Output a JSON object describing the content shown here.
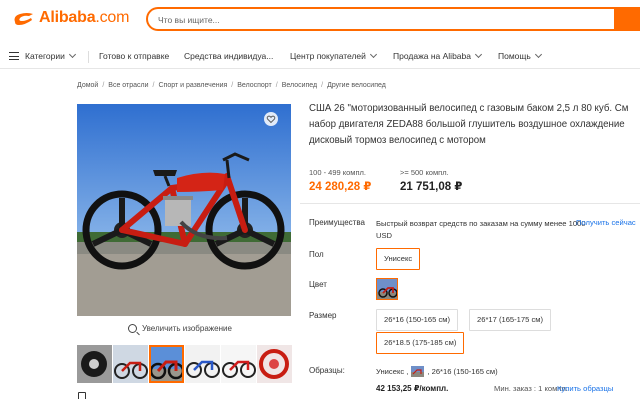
{
  "header": {
    "logo_text": "Alibaba",
    "logo_domain": ".com",
    "search_placeholder": "Что вы ищите...",
    "brand_color": "#ff6a00"
  },
  "nav": {
    "categories": "Категории",
    "items": [
      "Готово к отправке",
      "Средства индивидуа...",
      "Центр покупателей",
      "Продажа на Alibaba",
      "Помощь"
    ]
  },
  "breadcrumb": [
    "Домой",
    "Все отрасли",
    "Спорт и развлечения",
    "Велоспорт",
    "Велосипед",
    "Другие велосипед"
  ],
  "gallery": {
    "zoom_label": "Увеличить изображение",
    "thumb_count": 6,
    "selected_thumb": 2
  },
  "product": {
    "title": "США 26 \"моторизованный велосипед с газовым баком 2,5 л 80 куб. См набор двигателя ZEDA88 большой глушитель воздушное охлаждение дисковый тормоз велосипед с мотором",
    "tiers": [
      {
        "qty": "100 - 499 компл.",
        "price": "24 280,28 ₽"
      },
      {
        "qty": ">= 500 компл.",
        "price": "21 751,08 ₽"
      }
    ],
    "advantages_label": "Преимущества",
    "advantages_text": "Быстрый возврат средств по заказам на сумму менее 1000 USD",
    "advantages_link": "Получить сейчас",
    "gender_label": "Пол",
    "gender_option": "Унисекс",
    "color_label": "Цвет",
    "size_label": "Размер",
    "sizes": [
      "26*16 (150-165 см)",
      "26*17 (165-175 см)",
      "26*18.5 (175-185 см)"
    ],
    "samples_label": "Образцы:",
    "samples_gender": "Унисекс ,",
    "samples_size": ", 26*16 (150-165 см)",
    "sample_price": "42 153,25 ₽/компл.",
    "min_order": "Мин. заказ : 1 компл.",
    "buy_samples": "Купить образцы"
  }
}
